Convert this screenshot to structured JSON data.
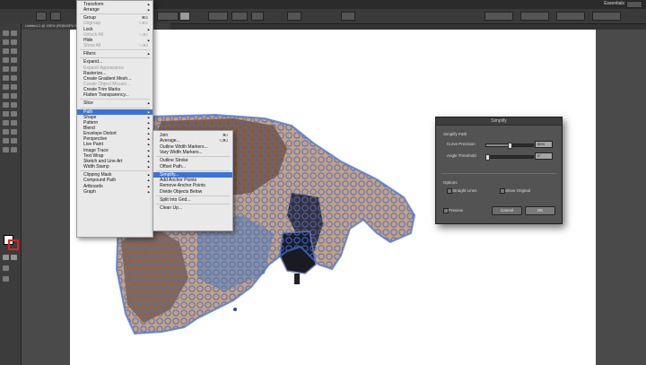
{
  "workspace": {
    "essentials_label": "Essentials"
  },
  "document_tab": {
    "label": "Untitled-1 @ 150% (RGB/GPU Preview)"
  },
  "object_menu": {
    "items": [
      {
        "label": "Transform",
        "disabled": false,
        "arrow": true,
        "shortcut": ""
      },
      {
        "label": "Arrange",
        "disabled": false,
        "arrow": true,
        "shortcut": ""
      },
      {
        "sep": true
      },
      {
        "label": "Group",
        "disabled": false,
        "arrow": false,
        "shortcut": "⌘G"
      },
      {
        "label": "Ungroup",
        "disabled": true,
        "arrow": false,
        "shortcut": "⇧⌘G"
      },
      {
        "label": "Lock",
        "disabled": false,
        "arrow": true,
        "shortcut": ""
      },
      {
        "label": "Unlock All",
        "disabled": true,
        "arrow": false,
        "shortcut": "⌥⌘2"
      },
      {
        "label": "Hide",
        "disabled": false,
        "arrow": true,
        "shortcut": ""
      },
      {
        "label": "Show All",
        "disabled": true,
        "arrow": false,
        "shortcut": "⌥⌘3"
      },
      {
        "sep": true
      },
      {
        "label": "Filters",
        "disabled": false,
        "arrow": true,
        "shortcut": ""
      },
      {
        "sep": true
      },
      {
        "label": "Expand...",
        "disabled": false,
        "arrow": false,
        "shortcut": ""
      },
      {
        "label": "Expand Appearance",
        "disabled": true,
        "arrow": false,
        "shortcut": ""
      },
      {
        "label": "Rasterize...",
        "disabled": false,
        "arrow": false,
        "shortcut": ""
      },
      {
        "label": "Create Gradient Mesh...",
        "disabled": false,
        "arrow": false,
        "shortcut": ""
      },
      {
        "label": "Create Object Mosaic...",
        "disabled": true,
        "arrow": false,
        "shortcut": ""
      },
      {
        "label": "Create Trim Marks",
        "disabled": false,
        "arrow": false,
        "shortcut": ""
      },
      {
        "label": "Flatten Transparency...",
        "disabled": false,
        "arrow": false,
        "shortcut": ""
      },
      {
        "sep": true
      },
      {
        "label": "Slice",
        "disabled": false,
        "arrow": true,
        "shortcut": ""
      },
      {
        "sep": true
      },
      {
        "label": "Path",
        "disabled": false,
        "arrow": true,
        "shortcut": "",
        "highlight": true
      },
      {
        "label": "Shape",
        "disabled": false,
        "arrow": true,
        "shortcut": ""
      },
      {
        "label": "Pattern",
        "disabled": false,
        "arrow": true,
        "shortcut": ""
      },
      {
        "label": "Blend",
        "disabled": false,
        "arrow": true,
        "shortcut": ""
      },
      {
        "label": "Envelope Distort",
        "disabled": false,
        "arrow": true,
        "shortcut": ""
      },
      {
        "label": "Perspective",
        "disabled": false,
        "arrow": true,
        "shortcut": ""
      },
      {
        "label": "Live Paint",
        "disabled": false,
        "arrow": true,
        "shortcut": ""
      },
      {
        "label": "Image Trace",
        "disabled": false,
        "arrow": true,
        "shortcut": ""
      },
      {
        "label": "Text Wrap",
        "disabled": false,
        "arrow": true,
        "shortcut": ""
      },
      {
        "label": "Sketch and Line Art",
        "disabled": false,
        "arrow": true,
        "shortcut": ""
      },
      {
        "label": "Width Stamp",
        "disabled": false,
        "arrow": true,
        "shortcut": ""
      },
      {
        "sep": true
      },
      {
        "label": "Clipping Mask",
        "disabled": false,
        "arrow": true,
        "shortcut": ""
      },
      {
        "label": "Compound Path",
        "disabled": false,
        "arrow": true,
        "shortcut": ""
      },
      {
        "label": "Artboards",
        "disabled": false,
        "arrow": true,
        "shortcut": ""
      },
      {
        "label": "Graph",
        "disabled": false,
        "arrow": true,
        "shortcut": ""
      }
    ]
  },
  "path_submenu": {
    "items": [
      {
        "label": "Join",
        "shortcut": "⌘J",
        "disabled": false
      },
      {
        "label": "Average...",
        "shortcut": "⌥⌘J",
        "disabled": false
      },
      {
        "label": "Outline Width Markers...",
        "shortcut": "",
        "disabled": false
      },
      {
        "label": "Vary Width Markers...",
        "shortcut": "",
        "disabled": false
      },
      {
        "sep": true
      },
      {
        "label": "Outline Stroke",
        "shortcut": "",
        "disabled": false
      },
      {
        "label": "Offset Path...",
        "shortcut": "",
        "disabled": false
      },
      {
        "sep": true
      },
      {
        "label": "Simplify...",
        "shortcut": "",
        "disabled": false,
        "highlight": true
      },
      {
        "label": "Add Anchor Points",
        "shortcut": "",
        "disabled": false
      },
      {
        "label": "Remove Anchor Points",
        "shortcut": "",
        "disabled": false
      },
      {
        "label": "Divide Objects Below",
        "shortcut": "",
        "disabled": false
      },
      {
        "sep": true
      },
      {
        "label": "Split Into Grid...",
        "shortcut": "",
        "disabled": false
      },
      {
        "sep": true
      },
      {
        "label": "Clean Up...",
        "shortcut": "",
        "disabled": false
      }
    ]
  },
  "simplify_dialog": {
    "title": "Simplify",
    "section_path": "Simplify Path",
    "curve_precision_label": "Curve Precision",
    "curve_precision_value": "50%",
    "curve_precision_fraction": 0.5,
    "angle_threshold_label": "Angle Threshold",
    "angle_threshold_value": "0°",
    "angle_threshold_fraction": 0.0,
    "section_options": "Options",
    "straight_lines_label": "Straight Lines",
    "show_original_label": "Show Original",
    "preview_label": "Preview",
    "cancel_label": "Cancel",
    "ok_label": "OK"
  },
  "colors": {
    "highlight": "#3b74d4",
    "path_stroke": "#3f6fe0",
    "cow_brown": "#8b5a2b",
    "cow_tan": "#c9a27a",
    "cow_shadow": "#3a3030"
  }
}
